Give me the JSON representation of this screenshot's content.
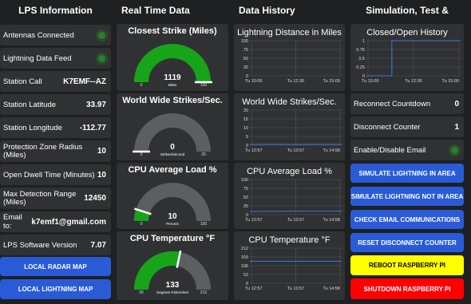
{
  "headers": {
    "lps": "LPS Information",
    "realtime": "Real Time Data",
    "history": "Data History",
    "sim": "Simulation, Test & Control"
  },
  "lps": {
    "antennas_label": "Antennas Connected",
    "lightning_feed_label": "Lightning Data Feed",
    "station_call_label": "Station Call",
    "station_call": "K7EMF--AZ",
    "lat_label": "Station Latitude",
    "lat": "33.97",
    "lon_label": "Station Longitude",
    "lon": "-112.77",
    "pz_label": "Protection Zone Radius (Miles)",
    "pz": "10",
    "dwell_label": "Open Dwell Time (Minutes)",
    "dwell": "10",
    "maxrange_label": "Max Detection Range (Miles)",
    "maxrange": "12450",
    "email_label": "Email to:",
    "email": "k7emf1@gmail.com",
    "version_label": "LPS Software Version",
    "version": "7.07",
    "radar_btn": "LOCAL RADAR MAP",
    "lightning_btn": "LOCAL LIGHTNING MAP",
    "led_color": "#2e7d32"
  },
  "gauges": [
    {
      "title": "Closest Strike (Miles)",
      "value": "1119",
      "unit": "Miles",
      "min": "0",
      "max": "100",
      "fill": 1.0,
      "color": "#18a418"
    },
    {
      "title": "World Wide Strikes/Sec.",
      "value": "0",
      "unit": "Strikes/Second",
      "min": "0",
      "max": "20",
      "fill": 0.0,
      "color": "#18a418"
    },
    {
      "title": "CPU Average Load %",
      "value": "10",
      "unit": "Percent",
      "min": "0",
      "max": "100",
      "fill": 0.1,
      "color": "#18a418"
    },
    {
      "title": "CPU Temperature °F",
      "value": "133",
      "unit": "Degrees Fahrenheit",
      "min": "30",
      "max": "212",
      "fill": 0.565,
      "color": "#18a418"
    }
  ],
  "charts": [
    {
      "title": "Lightning Distance in Miles",
      "yticks": [
        "100",
        "75",
        "50",
        "25",
        "0"
      ],
      "xticks": [
        "Tu 10:00",
        "Tu 12:30",
        "Tu 15:00"
      ]
    },
    {
      "title": "World Wide Strikes/Sec.",
      "yticks": [
        "20",
        "15",
        "10",
        "5",
        "0"
      ],
      "xticks": [
        "Tu 12:57",
        "Tu 13:57",
        "Tu 14:58"
      ]
    },
    {
      "title": "CPU Average Load %",
      "yticks": [
        "100",
        "75",
        "50",
        "25",
        "0"
      ],
      "xticks": [
        "Tu 12:57",
        "Tu 13:57",
        "Tu 14:58"
      ]
    },
    {
      "title": "CPU Temperature °F",
      "yticks": [
        "212",
        "159",
        "106",
        "53",
        "0"
      ],
      "xticks": [
        "Tu 12:57",
        "Tu 13:57",
        "Tu 14:58"
      ]
    }
  ],
  "chart_data": [
    {
      "type": "line",
      "title": "Lightning Distance in Miles",
      "x": [],
      "values": [],
      "ylim": [
        0,
        100
      ],
      "xticks": [
        "Tu 10:00",
        "Tu 12:30",
        "Tu 15:00"
      ]
    },
    {
      "type": "line",
      "title": "World Wide Strikes/Sec.",
      "x": [
        "Tu 12:57",
        "Tu 13:57",
        "Tu 14:58"
      ],
      "values": [
        0.5,
        0.5,
        0.5
      ],
      "ylim": [
        0,
        20
      ]
    },
    {
      "type": "line",
      "title": "CPU Average Load %",
      "x": [
        "Tu 12:57",
        "Tu 13:57",
        "Tu 14:58"
      ],
      "values": [
        9,
        10,
        10
      ],
      "ylim": [
        0,
        100
      ]
    },
    {
      "type": "line",
      "title": "CPU Temperature °F",
      "x": [
        "Tu 12:57",
        "Tu 13:57",
        "Tu 14:58"
      ],
      "values": [
        133,
        133,
        133
      ],
      "ylim": [
        0,
        212
      ]
    },
    {
      "type": "line",
      "title": "Closed/Open History",
      "x": [
        "Tu 10:00",
        "Tu 12:30",
        "Tu 15:00"
      ],
      "values": [
        0,
        1,
        1
      ],
      "ylim": [
        0,
        1
      ],
      "yticks": [
        "1",
        "0.75",
        "0.5",
        "0.25",
        "0"
      ]
    }
  ],
  "sim": {
    "history_title": "Closed/Open History",
    "history_yticks": [
      "1",
      "0.75",
      "0.5",
      "0.25",
      "0"
    ],
    "history_xticks": [
      "Tu 10:00",
      "Tu 12:30",
      "Tu 15:00"
    ],
    "reconnect_label": "Reconnect Countdown",
    "reconnect": "0",
    "disconnect_label": "Disconnect Counter",
    "disconnect": "1",
    "email_label": "Enable/Disable Email",
    "buttons": [
      {
        "label": "SIMULATE LIGHTNING IN AREA",
        "style": "blue"
      },
      {
        "label": "SIMULATE LIGHTNING NOT IN AREA",
        "style": "blue"
      },
      {
        "label": "CHECK EMAIL COMMUNICATIONS",
        "style": "blue"
      },
      {
        "label": "RESET DISCONNECT COUNTER",
        "style": "blue"
      },
      {
        "label": "REBOOT RASPBERRY PI",
        "style": "yellow"
      },
      {
        "label": "SHUTDOWN RASPBERRY PI",
        "style": "red"
      }
    ]
  }
}
